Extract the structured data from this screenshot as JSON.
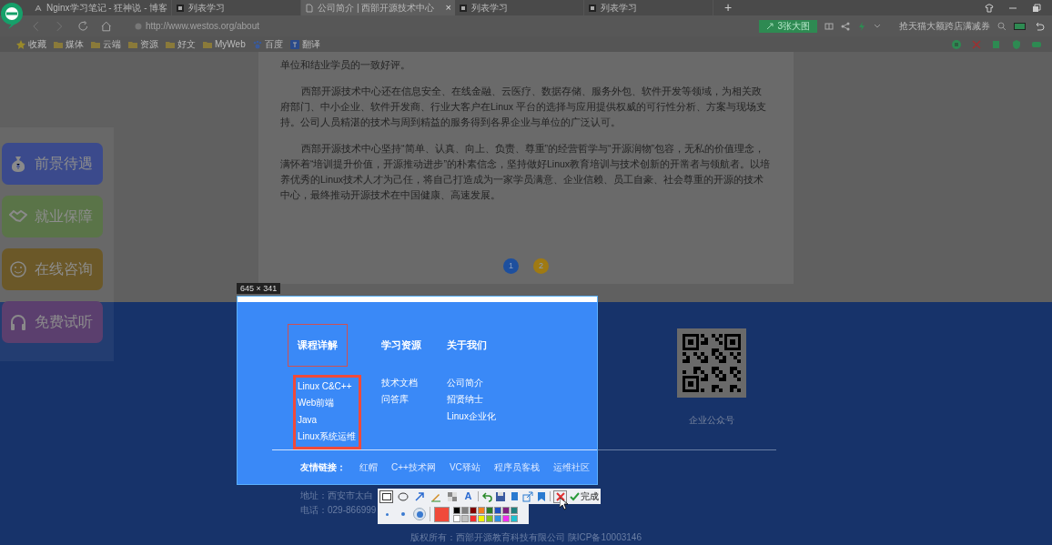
{
  "browser": {
    "tabs": [
      {
        "title": "Nginx学习笔记 - 狂神说 - 博客",
        "kind": "ghost",
        "selected": false
      },
      {
        "title": "列表学习",
        "kind": "book",
        "selected": false
      },
      {
        "title": "公司简介 | 西部开源技术中心",
        "kind": "page",
        "selected": true,
        "close": "×"
      },
      {
        "title": "列表学习",
        "kind": "book",
        "selected": false
      },
      {
        "title": "列表学习",
        "kind": "book",
        "selected": false
      }
    ],
    "new_tab": "+",
    "address": "http://www.westos.org/about",
    "image_badge": "3张大图",
    "search_promo": "抢天猫大额跨店满减券",
    "bookmarks": [
      {
        "label": "收藏",
        "kind": "star"
      },
      {
        "label": "媒体",
        "kind": "folder"
      },
      {
        "label": "云端",
        "kind": "folder"
      },
      {
        "label": "资源",
        "kind": "folder"
      },
      {
        "label": "好文",
        "kind": "folder"
      },
      {
        "label": "MyWeb",
        "kind": "folder"
      },
      {
        "label": "百度",
        "kind": "paw"
      },
      {
        "label": "翻译",
        "kind": "translate"
      }
    ]
  },
  "article": {
    "paragraphs": [
      {
        "text": "单位和结业学员的一致好评。"
      },
      {
        "text": "西部开源技术中心还在信息安全、在线金融、云医疗、数据存储、服务外包、软件开发等领域，为相关政府部门、中小企业、软件开发商、行业大客户在Linux 平台的选择与应用提供权威的可行性分析、方案与现场支持。公司人员精湛的技术与周到精益的服务得到各界企业与单位的广泛认可。"
      },
      {
        "text": "西部开源技术中心坚持“简单、认真、向上、负责、尊重”的经营哲学与“开源润物”包容，无私的价值理念，满怀着“培训提升价值，开源推动进步”的朴素信念，坚持做好Linux教育培训与技术创新的开凿者与领航者。以培养优秀的Linux技术人才为己任，将自己打造成为一家学员满意、企业信赖、员工自豪、社会尊重的开源的技术中心，最终推动开源技术在中国健康、高速发展。"
      }
    ]
  },
  "pagination": [
    {
      "label": "1",
      "color": "#1d4f9e"
    },
    {
      "label": "2",
      "color": "#a07a12"
    }
  ],
  "side_buttons": [
    {
      "label": "前景待遇",
      "color": "#3b4a8c"
    },
    {
      "label": "就业保障",
      "color": "#5a7448"
    },
    {
      "label": "在线咨询",
      "color": "#6b5828"
    },
    {
      "label": "免费试听",
      "color": "#5b3f6e"
    }
  ],
  "screenshot_tool": {
    "size_label": "645 × 341",
    "selection": {
      "columns": [
        {
          "heading": "课程详解",
          "heading_marked": true,
          "links_marked": true,
          "links": [
            "Linux C&C++",
            "Web前端",
            "Java",
            "Linux系统运维"
          ]
        },
        {
          "heading": "学习资源",
          "heading_marked": false,
          "links_marked": false,
          "links": [
            "技术文档",
            "问答库"
          ]
        },
        {
          "heading": "关于我们",
          "heading_marked": false,
          "links_marked": false,
          "links": [
            "公司简介",
            "招贤纳士",
            "Linux企业化"
          ]
        }
      ],
      "friend_links_label": "友情链接：",
      "friend_links": [
        "红帽",
        "C++技术网",
        "VC驿站",
        "程序员客栈",
        "运维社区"
      ]
    },
    "tools": [
      {
        "kind": "rectangle",
        "selected": true
      },
      {
        "kind": "ellipse",
        "selected": false
      },
      {
        "kind": "arrow",
        "selected": false
      },
      {
        "kind": "pen",
        "selected": false
      },
      {
        "kind": "mosaic",
        "selected": false
      },
      {
        "kind": "text",
        "glyph": "A",
        "selected": false
      }
    ],
    "done_label": "完成",
    "brush_sizes": [
      {
        "selected": false
      },
      {
        "selected": false
      },
      {
        "selected": true
      }
    ],
    "current_color": {
      "color": "#f04a3a"
    },
    "swatches": [
      {
        "color": "#000000"
      },
      {
        "color": "#808080"
      },
      {
        "color": "#800000"
      },
      {
        "color": "#f08020"
      },
      {
        "color": "#2a7a2a"
      },
      {
        "color": "#2050c0"
      },
      {
        "color": "#802080"
      },
      {
        "color": "#208080"
      },
      {
        "color": "#ffffff"
      },
      {
        "color": "#c0c0c0"
      },
      {
        "color": "#f03030"
      },
      {
        "color": "#f0f000"
      },
      {
        "color": "#80c020"
      },
      {
        "color": "#3090e0"
      },
      {
        "color": "#f030f0"
      },
      {
        "color": "#20c0d0"
      }
    ]
  },
  "footer": {
    "qr_caption": "企业公众号",
    "address": "地址：西安市太白",
    "phone": "电话：029-866999",
    "copyright": "版权所有：西部开源教育科技有限公司 陕ICP备10003146"
  }
}
